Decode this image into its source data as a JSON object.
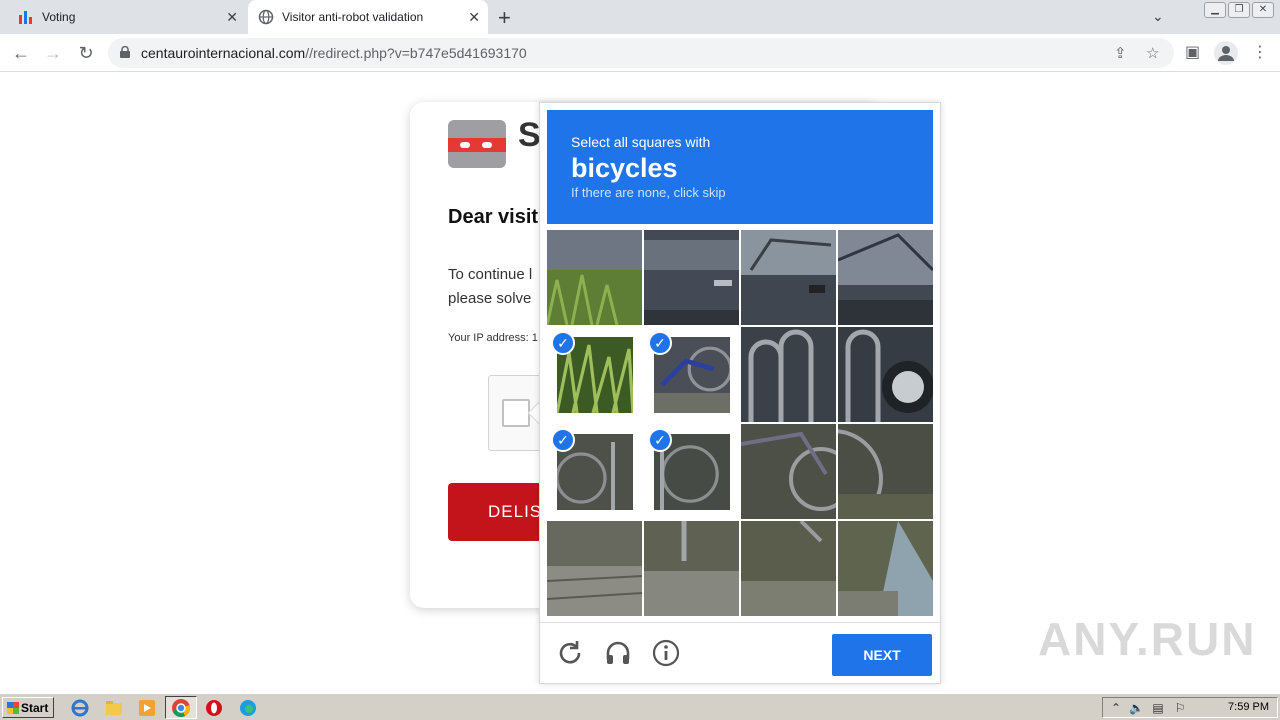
{
  "browser": {
    "tabs": [
      {
        "title": "Voting",
        "active": false
      },
      {
        "title": "Visitor anti-robot validation",
        "active": true
      }
    ],
    "url_host": "centaurointernacional.com",
    "url_path": "//redirect.php?v=b747e5d41693170"
  },
  "page": {
    "logo_letter": "S",
    "heading": "Dear visit",
    "line1": "To continue l",
    "line2": "please solve",
    "ip_label": "Your IP address: 1",
    "button_label": "DELIS"
  },
  "captcha": {
    "prompt_line1": "Select all squares with",
    "prompt_object": "bicycles",
    "prompt_hint": "If there are none, click skip",
    "selected_tiles": [
      4,
      5,
      8,
      9
    ],
    "next_label": "NEXT",
    "accent_color": "#1e74e8"
  },
  "watermark": "ANY.RUN",
  "taskbar": {
    "start_label": "Start",
    "clock": "7:59 PM"
  }
}
